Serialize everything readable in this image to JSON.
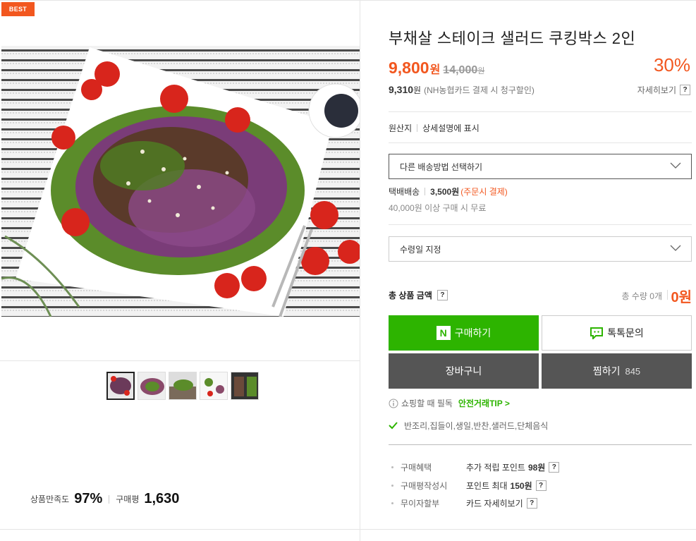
{
  "badge": "BEST",
  "product": {
    "title": "부채살 스테이크 샐러드 쿠킹박스 2인",
    "price": "9,800",
    "price_unit": "원",
    "original_price": "14,000",
    "original_unit": "원",
    "discount": "30%",
    "card_price": "9,310",
    "card_unit": "원",
    "card_note": "(NH농협카드 결제 시 청구할인)",
    "detail_link": "자세히보기",
    "help": "?"
  },
  "origin": {
    "label": "원산지",
    "value": "상세설명에 표시"
  },
  "shipping_select": "다른 배송방법 선택하기",
  "shipping": {
    "method": "택배배송",
    "fee": "3,500원",
    "fee_note": "(주문시 결제)",
    "free_note": "40,000원 이상 구매 시 무료"
  },
  "receive_date_select": "수령일 지정",
  "total": {
    "label": "총 상품 금액",
    "qty": "총 수량 0개",
    "value": "0원"
  },
  "buttons": {
    "buy": "구매하기",
    "buy_logo": "N",
    "talk": "톡톡문의",
    "cart": "장바구니",
    "wish": "찜하기",
    "wish_count": "845"
  },
  "tip": {
    "text": "쇼핑할 때 필독",
    "link": "안전거래TIP >"
  },
  "category": "반조리,집들이,생일,반찬,샐러드,단체음식",
  "benefits": [
    {
      "key": "구매혜택",
      "text": "추가 적립 포인트",
      "bold": "98원"
    },
    {
      "key": "구매평작성시",
      "text": "포인트 최대",
      "bold": "150원"
    },
    {
      "key": "무이자할부",
      "text": "카드 자세히보기",
      "bold": ""
    }
  ],
  "rating": {
    "satisfaction_label": "상품만족도",
    "satisfaction_value": "97%",
    "review_label": "구매평",
    "review_value": "1,630"
  },
  "colors": {
    "accent": "#f2571f",
    "naver_green": "#2db400",
    "dark_button": "#555555"
  }
}
